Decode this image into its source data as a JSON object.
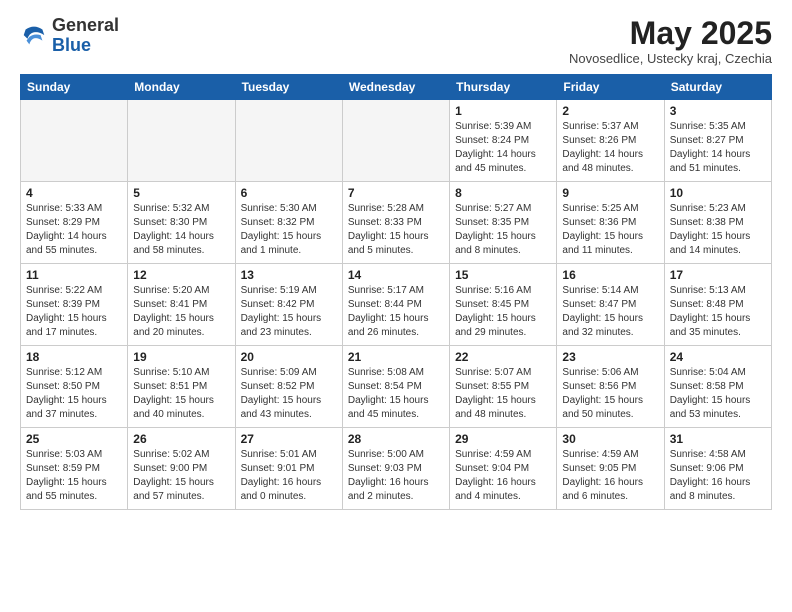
{
  "logo": {
    "general": "General",
    "blue": "Blue"
  },
  "title": "May 2025",
  "subtitle": "Novosedlice, Ustecky kraj, Czechia",
  "days_of_week": [
    "Sunday",
    "Monday",
    "Tuesday",
    "Wednesday",
    "Thursday",
    "Friday",
    "Saturday"
  ],
  "weeks": [
    [
      {
        "day": "",
        "info": ""
      },
      {
        "day": "",
        "info": ""
      },
      {
        "day": "",
        "info": ""
      },
      {
        "day": "",
        "info": ""
      },
      {
        "day": "1",
        "info": "Sunrise: 5:39 AM\nSunset: 8:24 PM\nDaylight: 14 hours\nand 45 minutes."
      },
      {
        "day": "2",
        "info": "Sunrise: 5:37 AM\nSunset: 8:26 PM\nDaylight: 14 hours\nand 48 minutes."
      },
      {
        "day": "3",
        "info": "Sunrise: 5:35 AM\nSunset: 8:27 PM\nDaylight: 14 hours\nand 51 minutes."
      }
    ],
    [
      {
        "day": "4",
        "info": "Sunrise: 5:33 AM\nSunset: 8:29 PM\nDaylight: 14 hours\nand 55 minutes."
      },
      {
        "day": "5",
        "info": "Sunrise: 5:32 AM\nSunset: 8:30 PM\nDaylight: 14 hours\nand 58 minutes."
      },
      {
        "day": "6",
        "info": "Sunrise: 5:30 AM\nSunset: 8:32 PM\nDaylight: 15 hours\nand 1 minute."
      },
      {
        "day": "7",
        "info": "Sunrise: 5:28 AM\nSunset: 8:33 PM\nDaylight: 15 hours\nand 5 minutes."
      },
      {
        "day": "8",
        "info": "Sunrise: 5:27 AM\nSunset: 8:35 PM\nDaylight: 15 hours\nand 8 minutes."
      },
      {
        "day": "9",
        "info": "Sunrise: 5:25 AM\nSunset: 8:36 PM\nDaylight: 15 hours\nand 11 minutes."
      },
      {
        "day": "10",
        "info": "Sunrise: 5:23 AM\nSunset: 8:38 PM\nDaylight: 15 hours\nand 14 minutes."
      }
    ],
    [
      {
        "day": "11",
        "info": "Sunrise: 5:22 AM\nSunset: 8:39 PM\nDaylight: 15 hours\nand 17 minutes."
      },
      {
        "day": "12",
        "info": "Sunrise: 5:20 AM\nSunset: 8:41 PM\nDaylight: 15 hours\nand 20 minutes."
      },
      {
        "day": "13",
        "info": "Sunrise: 5:19 AM\nSunset: 8:42 PM\nDaylight: 15 hours\nand 23 minutes."
      },
      {
        "day": "14",
        "info": "Sunrise: 5:17 AM\nSunset: 8:44 PM\nDaylight: 15 hours\nand 26 minutes."
      },
      {
        "day": "15",
        "info": "Sunrise: 5:16 AM\nSunset: 8:45 PM\nDaylight: 15 hours\nand 29 minutes."
      },
      {
        "day": "16",
        "info": "Sunrise: 5:14 AM\nSunset: 8:47 PM\nDaylight: 15 hours\nand 32 minutes."
      },
      {
        "day": "17",
        "info": "Sunrise: 5:13 AM\nSunset: 8:48 PM\nDaylight: 15 hours\nand 35 minutes."
      }
    ],
    [
      {
        "day": "18",
        "info": "Sunrise: 5:12 AM\nSunset: 8:50 PM\nDaylight: 15 hours\nand 37 minutes."
      },
      {
        "day": "19",
        "info": "Sunrise: 5:10 AM\nSunset: 8:51 PM\nDaylight: 15 hours\nand 40 minutes."
      },
      {
        "day": "20",
        "info": "Sunrise: 5:09 AM\nSunset: 8:52 PM\nDaylight: 15 hours\nand 43 minutes."
      },
      {
        "day": "21",
        "info": "Sunrise: 5:08 AM\nSunset: 8:54 PM\nDaylight: 15 hours\nand 45 minutes."
      },
      {
        "day": "22",
        "info": "Sunrise: 5:07 AM\nSunset: 8:55 PM\nDaylight: 15 hours\nand 48 minutes."
      },
      {
        "day": "23",
        "info": "Sunrise: 5:06 AM\nSunset: 8:56 PM\nDaylight: 15 hours\nand 50 minutes."
      },
      {
        "day": "24",
        "info": "Sunrise: 5:04 AM\nSunset: 8:58 PM\nDaylight: 15 hours\nand 53 minutes."
      }
    ],
    [
      {
        "day": "25",
        "info": "Sunrise: 5:03 AM\nSunset: 8:59 PM\nDaylight: 15 hours\nand 55 minutes."
      },
      {
        "day": "26",
        "info": "Sunrise: 5:02 AM\nSunset: 9:00 PM\nDaylight: 15 hours\nand 57 minutes."
      },
      {
        "day": "27",
        "info": "Sunrise: 5:01 AM\nSunset: 9:01 PM\nDaylight: 16 hours\nand 0 minutes."
      },
      {
        "day": "28",
        "info": "Sunrise: 5:00 AM\nSunset: 9:03 PM\nDaylight: 16 hours\nand 2 minutes."
      },
      {
        "day": "29",
        "info": "Sunrise: 4:59 AM\nSunset: 9:04 PM\nDaylight: 16 hours\nand 4 minutes."
      },
      {
        "day": "30",
        "info": "Sunrise: 4:59 AM\nSunset: 9:05 PM\nDaylight: 16 hours\nand 6 minutes."
      },
      {
        "day": "31",
        "info": "Sunrise: 4:58 AM\nSunset: 9:06 PM\nDaylight: 16 hours\nand 8 minutes."
      }
    ]
  ]
}
